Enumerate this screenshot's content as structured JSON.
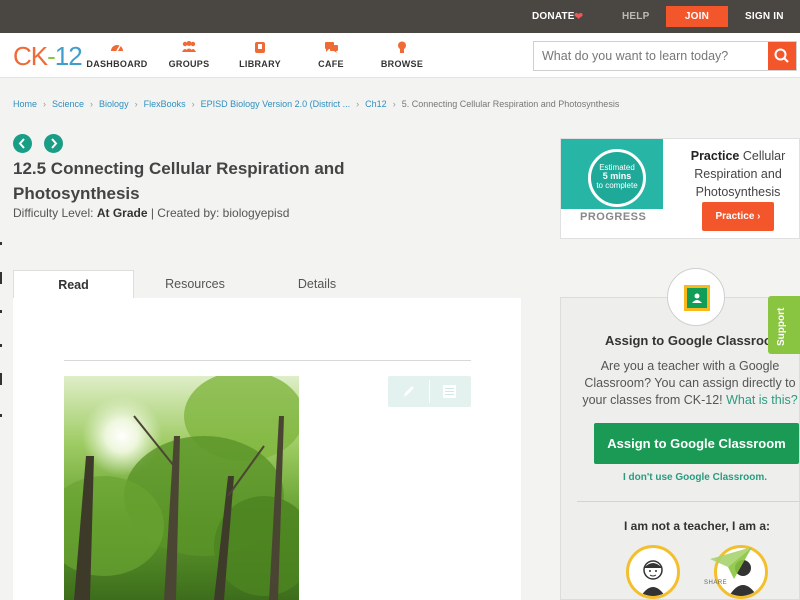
{
  "topbar": {
    "donate": "DONATE",
    "help": "HELP",
    "join": "JOIN",
    "signin": "SIGN IN"
  },
  "header": {
    "logo_ck": "CK",
    "logo_dash": "-",
    "logo_12": "12",
    "nav": [
      {
        "label": "DASHBOARD",
        "icon": "dashboard-icon"
      },
      {
        "label": "GROUPS",
        "icon": "groups-icon"
      },
      {
        "label": "LIBRARY",
        "icon": "library-icon"
      },
      {
        "label": "CAFE",
        "icon": "cafe-icon"
      },
      {
        "label": "BROWSE",
        "icon": "browse-icon"
      }
    ],
    "search_placeholder": "What do you want to learn today?"
  },
  "breadcrumb": [
    "Home",
    "Science",
    "Biology",
    "FlexBooks",
    "EPISD Biology Version 2.0 (District ...",
    "Ch12",
    "5. Connecting Cellular Respiration and Photosynthesis"
  ],
  "lesson": {
    "title": "12.5 Connecting Cellular Respiration and Photosynthesis",
    "difficulty_label": "Difficulty Level:",
    "difficulty_value": "At Grade",
    "created_by": "| Created by: biologyepisd",
    "tabs": [
      "Read",
      "Resources",
      "Details"
    ]
  },
  "practice": {
    "estimated_line1": "Estimated",
    "estimated_line2": "5 mins",
    "estimated_line3": "to complete",
    "progress": "PROGRESS",
    "heading_bold": "Practice",
    "heading_rest": "Cellular Respiration and Photosynthesis",
    "button": "Practice"
  },
  "classroom": {
    "title": "Assign to Google Classroom",
    "text": "Are you a teacher with a Google Classroom? You can assign directly to your classes from CK-12!",
    "what_link": "What is this?",
    "button": "Assign to Google Classroom",
    "dont_use": "I don't use Google Classroom.",
    "not_teacher": "I am not a teacher, I am a:",
    "share": "SHARE"
  },
  "support": "Support",
  "colors": {
    "brand_orange": "#f4562b",
    "teal": "#1a9d86",
    "classroom_green": "#1a9a55",
    "support_green": "#89c540"
  }
}
